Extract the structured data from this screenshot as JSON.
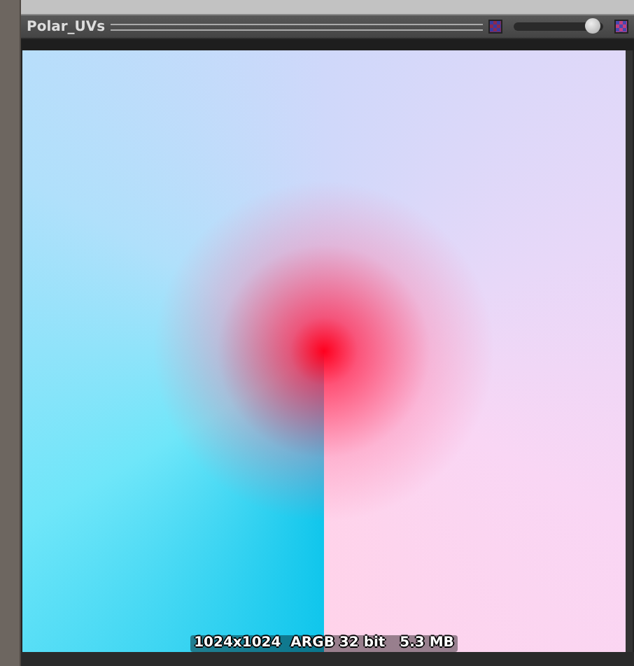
{
  "preview": {
    "title": "Polar_UVs",
    "info": "1024x1024  ARGB 32 bit   5.3 MB",
    "zoom_slider": {
      "level": 0.88
    }
  }
}
